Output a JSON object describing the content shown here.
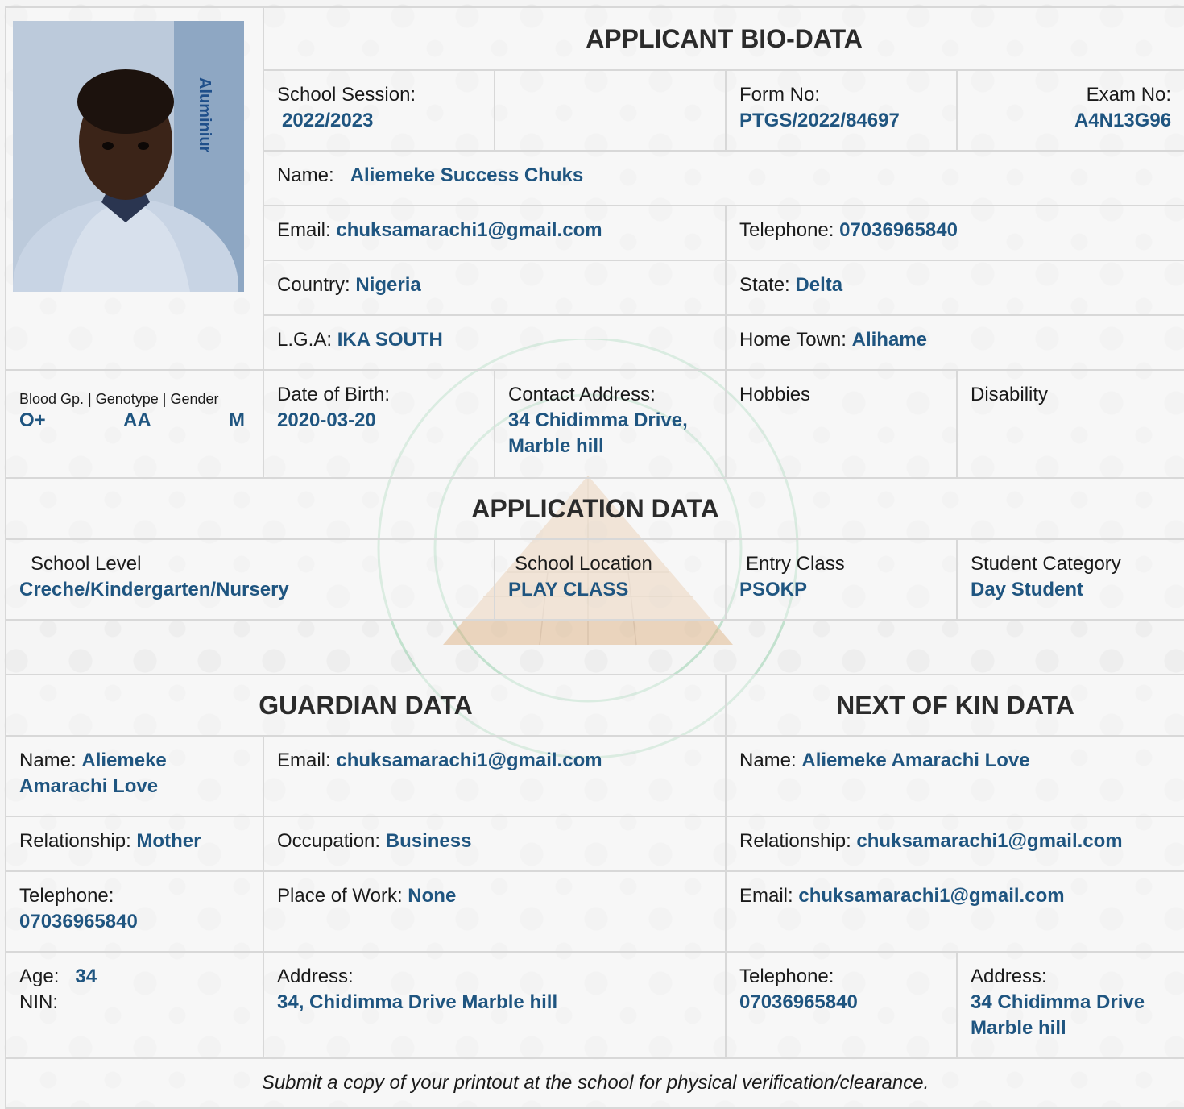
{
  "bio": {
    "title": "APPLICANT BIO-DATA",
    "session_label": "School Session:",
    "session": "2022/2023",
    "form_label": "Form No:",
    "form": "PTGS/2022/84697",
    "exam_label": "Exam No:",
    "exam": "A4N13G96",
    "name_label": "Name:",
    "name": "Aliemeke Success Chuks",
    "email_label": "Email:",
    "email": "chuksamarachi1@gmail.com",
    "tel_label": "Telephone:",
    "tel": "07036965840",
    "country_label": "Country:",
    "country": "Nigeria",
    "state_label": "State:",
    "state": "Delta",
    "lga_label": "L.G.A:",
    "lga": "IKA SOUTH",
    "hometown_label": "Home Town:",
    "hometown": "Alihame",
    "bgg_label": "Blood Gp. | Genotype | Gender",
    "blood": "O+",
    "genotype": "AA",
    "gender": "M",
    "dob_label": "Date of Birth:",
    "dob": "2020-03-20",
    "address_label": "Contact Address:",
    "address": "34 Chidimma Drive, Marble hill",
    "hobbies_label": "Hobbies",
    "disability_label": "Disability",
    "photo_text": "Aluminiur"
  },
  "application": {
    "title": "APPLICATION DATA",
    "level_label": "School Level",
    "level": "Creche/Kindergarten/Nursery",
    "location_label": "School Location",
    "location": "PLAY CLASS",
    "entry_label": "Entry Class",
    "entry": "PSOKP",
    "category_label": "Student Category",
    "category": "Day Student"
  },
  "guardian": {
    "title": "GUARDIAN DATA",
    "name_label": "Name:",
    "name": "Aliemeke Amarachi Love",
    "email_label": "Email:",
    "email": "chuksamarachi1@gmail.com",
    "relationship_label": "Relationship:",
    "relationship": "Mother",
    "occupation_label": "Occupation:",
    "occupation": "Business",
    "tel_label": "Telephone:",
    "tel": "07036965840",
    "work_label": "Place of Work:",
    "work": "None",
    "age_label": "Age:",
    "age": "34",
    "nin_label": "NIN:",
    "address_label": "Address:",
    "address": "34, Chidimma Drive Marble hill"
  },
  "kin": {
    "title": "NEXT OF KIN DATA",
    "name_label": "Name:",
    "name": "Aliemeke Amarachi Love",
    "relationship_label": "Relationship:",
    "relationship": "chuksamarachi1@gmail.com",
    "email_label": "Email:",
    "email": "chuksamarachi1@gmail.com",
    "tel_label": "Telephone:",
    "tel": "07036965840",
    "address_label": "Address:",
    "address": "34 Chidimma Drive Marble hill"
  },
  "footer": "Submit a copy of your printout at the school for physical verification/clearance.",
  "colors": {
    "value": "#1f5580",
    "watermark": "#3fae6a",
    "pyramid": "#d9a36b"
  }
}
